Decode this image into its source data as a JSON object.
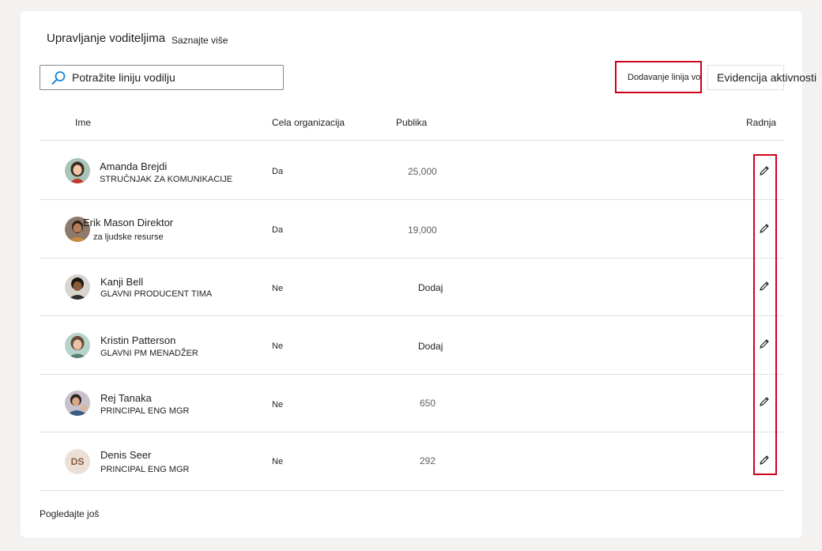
{
  "header": {
    "title": "Upravljanje voditeljima",
    "learn_more": "Saznajte više"
  },
  "search": {
    "placeholder": "Potražite liniju vodilju"
  },
  "toolbar": {
    "add_leader_label": "Dodavanje linija vodilja",
    "activity_log_label": "Evidencija aktivnosti"
  },
  "table": {
    "columns": {
      "name": "Ime",
      "org": "Cela organizacija",
      "audience": "Publika",
      "action": "Radnja"
    },
    "rows": [
      {
        "name": "Amanda Brejdi",
        "title": "STRUČNJAK ZA KOMUNIKACIJE",
        "org": "Da",
        "audience": "25,000",
        "avatar": "photo-amanda"
      },
      {
        "name": "Erik Mason Direktor",
        "title": "za ljudske resurse",
        "org": "Da",
        "audience": "19,000",
        "avatar": "photo-erik"
      },
      {
        "name": "Kanji Bell",
        "title": "GLAVNI PRODUCENT TIMA",
        "org": "Ne",
        "audience": "Dodaj",
        "avatar": "photo-kanji"
      },
      {
        "name": "Kristin Patterson",
        "title": "GLAVNI PM MENADŽER",
        "org": "Ne",
        "audience": "Dodaj",
        "avatar": "photo-kristin"
      },
      {
        "name": "Rej Tanaka",
        "title": "PRINCIPAL ENG MGR",
        "org": "Ne",
        "audience": "650",
        "avatar": "photo-rej"
      },
      {
        "name": "Denis Seer",
        "title": "PRINCIPAL ENG MGR",
        "org": "Ne",
        "audience": "292",
        "avatar": "initials",
        "initials": "DS"
      }
    ]
  },
  "footer": {
    "see_more": "Pogledajte još"
  },
  "colors": {
    "highlight": "#d0021b",
    "search_icon": "#0078d4",
    "divider": "#e1dfdd"
  },
  "icons": {
    "search": "search-icon",
    "edit": "pencil-icon"
  }
}
